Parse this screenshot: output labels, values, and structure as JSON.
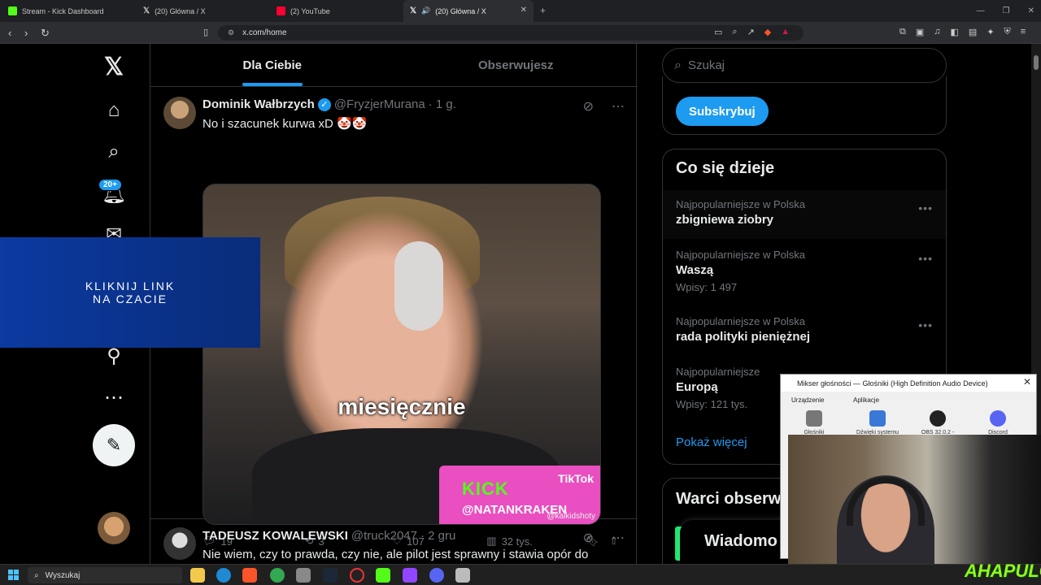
{
  "browser": {
    "tabs": [
      {
        "title": "Stream - Kick Dashboard",
        "color": "#53fc18"
      },
      {
        "title": "(20) Główna / X",
        "color": "#ffffff"
      },
      {
        "title": "(2) YouTube",
        "color": "#ff0033"
      },
      {
        "title": "(20) Główna / X",
        "color": "#ffffff",
        "active": true
      }
    ],
    "url": "x.com/home"
  },
  "feed": {
    "tabs": [
      "Dla Ciebie",
      "Obserwujesz"
    ],
    "notification_badge": "20+",
    "tweet1": {
      "name": "Dominik Wałbrzych",
      "handle": "@FryzjerMurana",
      "time": "· 1 g.",
      "text": "No i szacunek kurwa xD 🤡🤡",
      "caption": "miesięcznie",
      "kick_logo": "KICK",
      "kick_name": "@NATANKRAKEN",
      "tiktok": "TikTok",
      "tiktok_handle": "@kalkidshoty",
      "replies": "19",
      "reposts": "3",
      "likes": "107",
      "views": "32 tys."
    },
    "tweet2": {
      "name": "TADEUSZ KOWALEWSKI",
      "handle": "@truck2047",
      "time": "· 2 gru",
      "text": "Nie wiem, czy to prawda, czy nie, ale pilot jest sprawny i stawia opór do"
    }
  },
  "overlay": {
    "line1": "KLIKNIJ LINK",
    "line2": "NA CZACIE"
  },
  "sidebar": {
    "search_placeholder": "Szukaj",
    "subscribe": "Subskrybuj",
    "trends_title": "Co się dzieje",
    "trends": [
      {
        "context": "Najpopularniejsze w Polska",
        "name": "zbigniewa ziobry",
        "count": ""
      },
      {
        "context": "Najpopularniejsze w Polska",
        "name": "Waszą",
        "count": "Wpisy: 1 497"
      },
      {
        "context": "Najpopularniejsze w Polska",
        "name": "rada polityki pieniężnej",
        "count": ""
      },
      {
        "context": "Najpopularniejsze",
        "name": "Europą",
        "count": "Wpisy: 121 tys."
      }
    ],
    "show_more": "Pokaż więcej",
    "follow_title": "Warci obserw",
    "messages": "Wiadomo"
  },
  "mixer": {
    "title": "Mikser głośności — Głośniki (High Definition Audio Device)",
    "device_label": "Urządzenie",
    "apps_label": "Aplikacje",
    "items": [
      "Głośniki",
      "Dźwięki systemu",
      "OBS 32.0.2 -",
      "Discord"
    ]
  },
  "watermark": "AHAPULCO",
  "taskbar": {
    "search": "Wyszukaj"
  }
}
